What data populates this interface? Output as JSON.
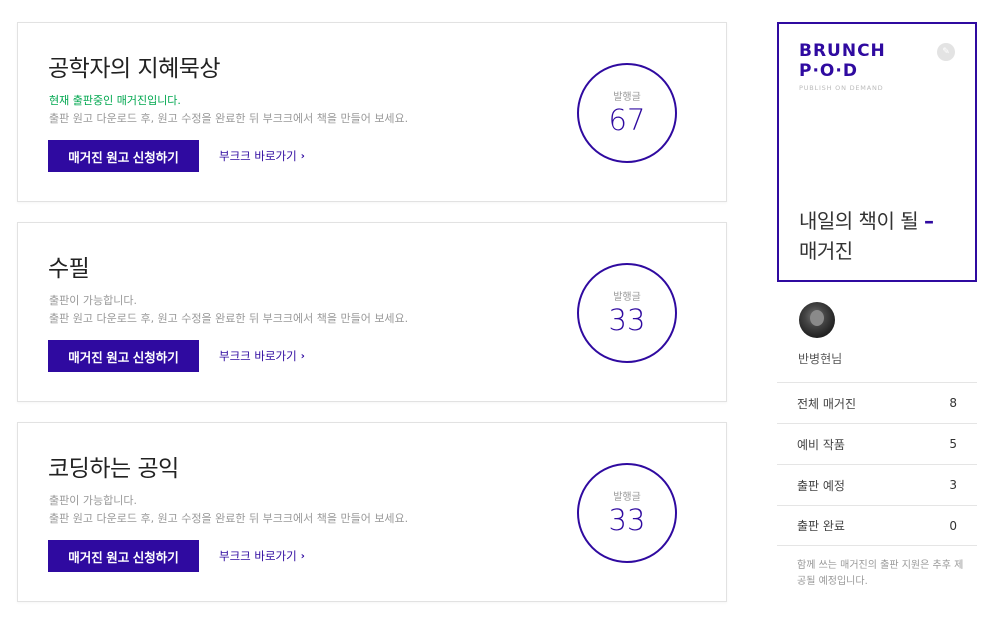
{
  "magazines": [
    {
      "title": "공학자의 지혜묵상",
      "status": "현재 출판중인 매거진입니다.",
      "status_active": true,
      "description": "출판 원고 다운로드 후, 원고 수정을 완료한 뒤 부크크에서 책을 만들어 보세요.",
      "apply_label": "매거진 원고 신청하기",
      "bookk_label": "부크크 바로가기",
      "count_label": "발행글",
      "count": "67"
    },
    {
      "title": "수필",
      "status": "출판이 가능합니다.",
      "status_active": false,
      "description": "출판 원고 다운로드 후, 원고 수정을 완료한 뒤 부크크에서 책을 만들어 보세요.",
      "apply_label": "매거진 원고 신청하기",
      "bookk_label": "부크크 바로가기",
      "count_label": "발행글",
      "count": "33"
    },
    {
      "title": "코딩하는 공익",
      "status": "출판이 가능합니다.",
      "status_active": false,
      "description": "출판 원고 다운로드 후, 원고 수정을 완료한 뒤 부크크에서 책을 만들어 보세요.",
      "apply_label": "매거진 원고 신청하기",
      "bookk_label": "부크크 바로가기",
      "count_label": "발행글",
      "count": "33"
    }
  ],
  "promo": {
    "logo_line1": "BRUNCH",
    "logo_line2": "P·O·D",
    "logo_sub": "PUBLISH ON DEMAND",
    "title_line1": "내일의 책이 될",
    "title_dash": "–",
    "title_line2": "매거진",
    "badge_icon": "pen-icon"
  },
  "user": {
    "name": "반병현님"
  },
  "stats": [
    {
      "label": "전체 매거진",
      "count": "8"
    },
    {
      "label": "예비 작품",
      "count": "5"
    },
    {
      "label": "출판 예정",
      "count": "3"
    },
    {
      "label": "출판 완료",
      "count": "0"
    }
  ],
  "note": "함께 쓰는 매거진의 출판 지원은 추후 제공될 예정입니다.",
  "colors": {
    "accent": "#2f0aa0",
    "active_status": "#00a74f"
  }
}
